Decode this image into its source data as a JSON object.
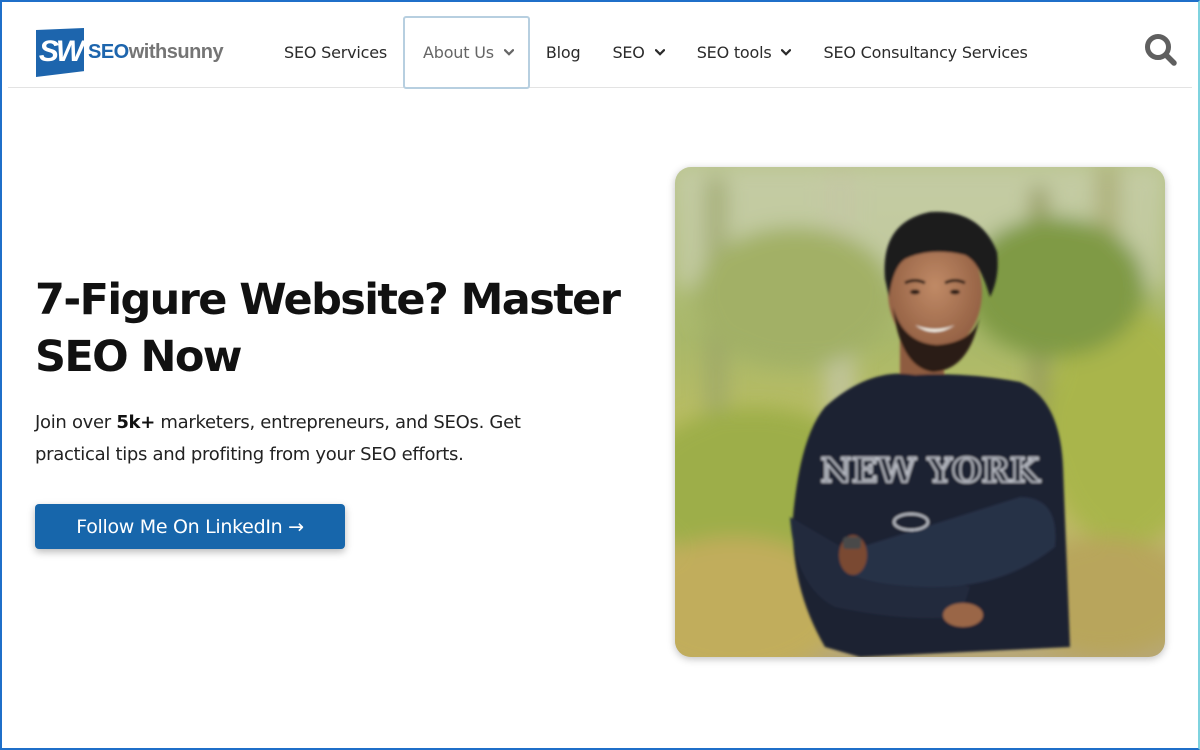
{
  "header": {
    "logo": {
      "mark": "SW",
      "text_primary": "SEO",
      "text_secondary": "withsunny",
      "brand_color": "#1d65ad"
    },
    "nav": [
      {
        "label": "SEO Services",
        "has_dropdown": false,
        "active": false
      },
      {
        "label": "About Us",
        "has_dropdown": true,
        "active": true
      },
      {
        "label": "Blog",
        "has_dropdown": false,
        "active": false
      },
      {
        "label": "SEO",
        "has_dropdown": true,
        "active": false
      },
      {
        "label": "SEO tools",
        "has_dropdown": true,
        "active": false
      },
      {
        "label": "SEO Consultancy Services",
        "has_dropdown": false,
        "active": false
      }
    ],
    "search_icon": "search-icon"
  },
  "hero": {
    "title_line1": "7-Figure Website? Master",
    "title_line2": "SEO Now",
    "subtitle_pre": "Join over ",
    "subtitle_bold": "5k+",
    "subtitle_post": " marketers, entrepreneurs, and SEOs. Get practical tips and profiting from your SEO efforts.",
    "cta_label": "Follow Me On LinkedIn →",
    "cta_color": "#1766ab",
    "photo_alt": "Smiling man in navy 'New York' sweatshirt with arms crossed, outdoor greenery background",
    "shirt_text": "NEW YORK"
  }
}
